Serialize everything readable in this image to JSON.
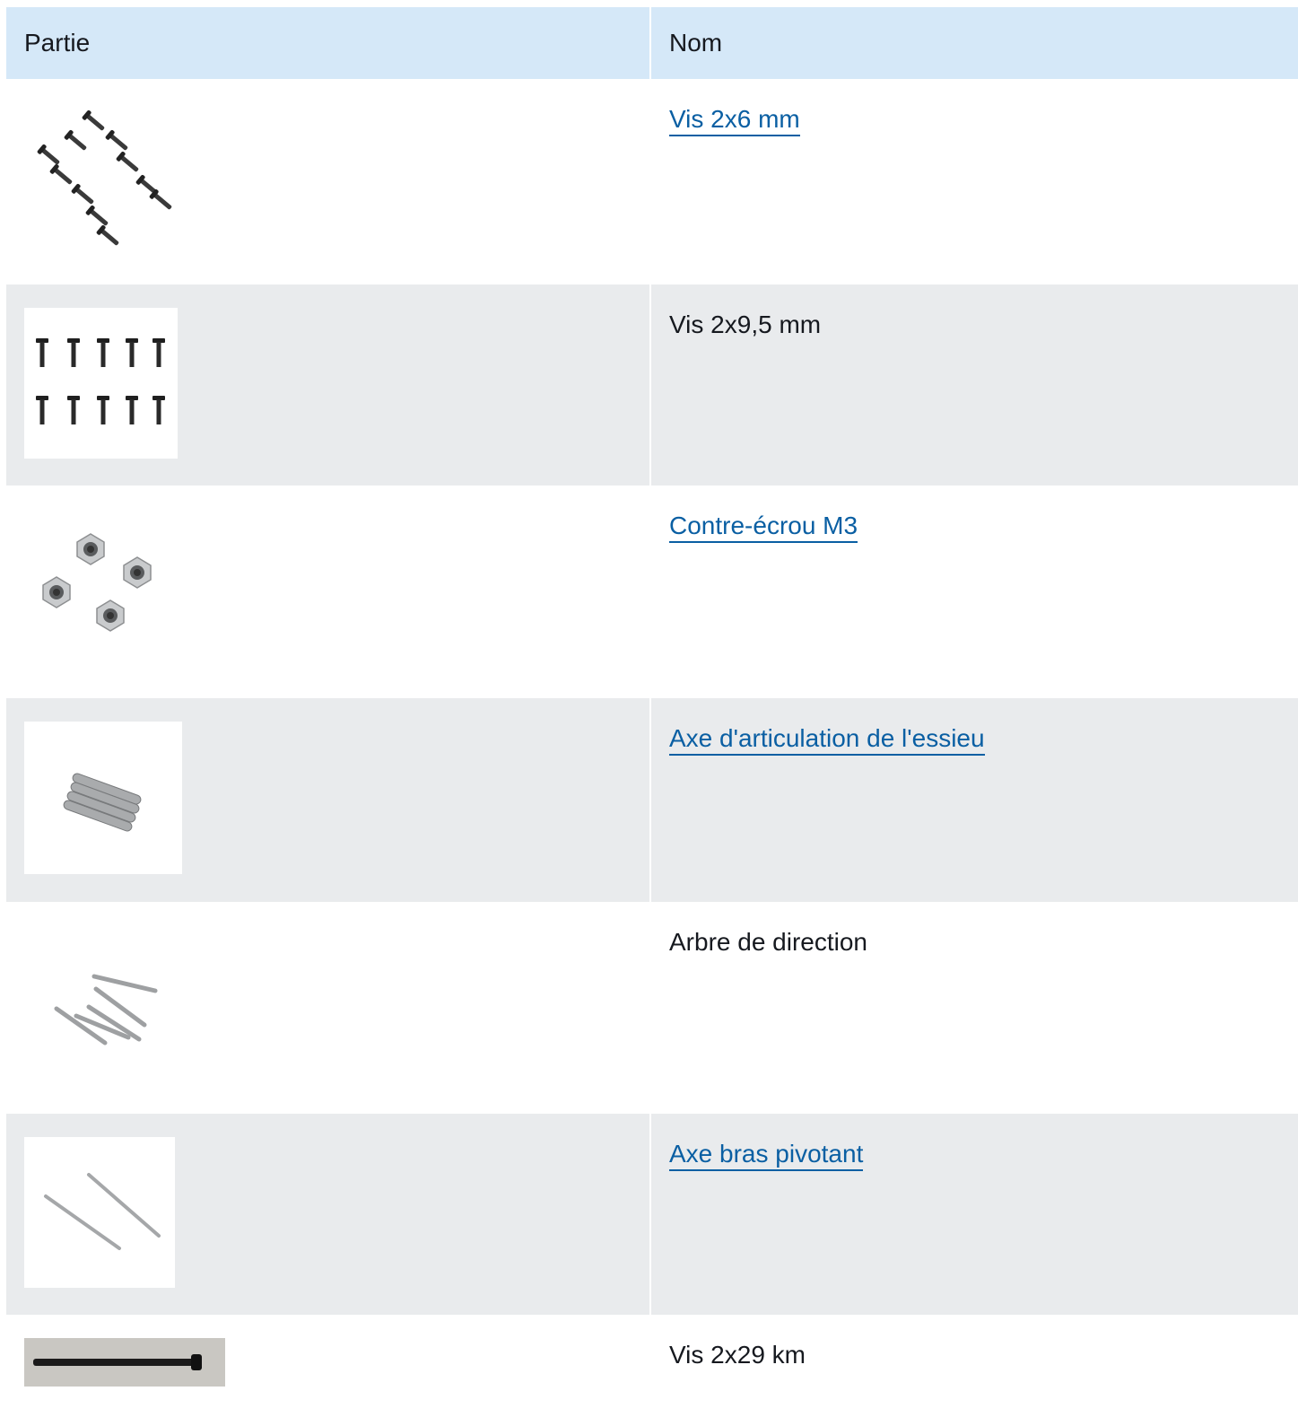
{
  "table": {
    "headers": {
      "part": "Partie",
      "name": "Nom"
    },
    "rows": [
      {
        "name": "Vis 2x6 mm",
        "link": true,
        "image": "screws-2x6-icon"
      },
      {
        "name": "Vis 2x9,5 mm",
        "link": false,
        "image": "screws-2x9-5-icon"
      },
      {
        "name": "Contre-écrou M3",
        "link": true,
        "image": "lock-nuts-m3-icon"
      },
      {
        "name": "Axe d'articulation de l'essieu",
        "link": true,
        "image": "axle-hinge-pins-icon"
      },
      {
        "name": "Arbre de direction",
        "link": false,
        "image": "steering-shafts-icon"
      },
      {
        "name": "Axe bras pivotant",
        "link": true,
        "image": "swing-arm-pins-icon"
      },
      {
        "name": "Vis 2x29 km",
        "link": false,
        "image": "screw-2x29-icon"
      }
    ]
  },
  "colors": {
    "header_bg": "#d5e8f8",
    "row_alt_bg": "#e9ebed",
    "link": "#0a5fa3",
    "text": "#16191f"
  }
}
